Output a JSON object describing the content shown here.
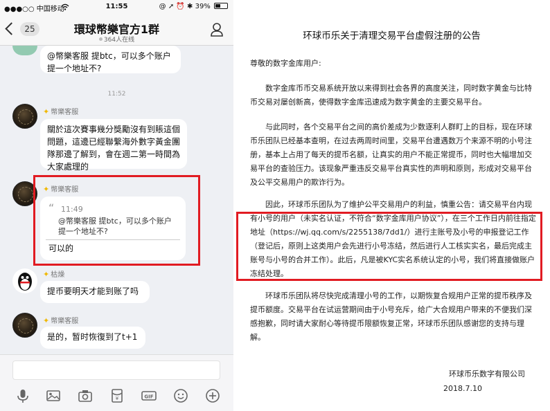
{
  "status_bar": {
    "carrier": "●●●○○ 中国移动",
    "wifi": "wifi-icon",
    "time": "11:55",
    "indicators": "@ ➚ ⏰ ✱ 39%"
  },
  "header": {
    "back_count": "25",
    "title": "環球幣樂官方1群",
    "online": "364人在线"
  },
  "chat": {
    "msg1_text": "@幣樂客服 提btc，可以多个账户提一个地址不?",
    "time_sep": "11:52",
    "msg2_sender": "幣樂客服",
    "msg2_text": "關於這次賽事幾分獎勵沒有到賬這個問題，這邊已經聯繫海外數字黃金團隊那邊了解到，會在週二第一時間為大家處理的",
    "msg3_sender": "幣樂客服",
    "msg3_quote_time": "11:49",
    "msg3_quote_text": "@幣樂客服 提btc，可以多个账户提一个地址不?",
    "msg3_text": "可以的",
    "msg4_sender": "枯燥",
    "msg4_text": "提币要明天才能到账了吗",
    "msg5_sender": "幣樂客服",
    "msg5_text": "是的，暂时恢復到了t+1"
  },
  "toolbar_icons": [
    "microphone-icon",
    "image-icon",
    "camera-icon",
    "red-packet-icon",
    "gif-icon",
    "emoji-icon",
    "plus-icon"
  ],
  "doc": {
    "title": "环球币乐关于清理交易平台虚假注册的公告",
    "salutation": "尊敬的数字金库用户:",
    "p1": "数字金库币币交易系统开放以来得到社会各界的高度关注，同时数字黄金与比特币交易对屡创新高，使得数字金库迅速成为数字黄金的主要交易平台。",
    "p2": "与此同时，各个交易平台之间的高价差成为少数逐利人群盯上的目标，现在环球币乐团队已经基本查明，在过去两周时间里，交易平台遭遇数万个来源不明的小号注册，基本上占用了每天的提币名额，让真实的用户不能正常提币，同时也大幅增加交易平台的查验压力。该现象严重违反交易平台真实性的声明和原则，形成对交易平台及公平交易用户的欺诈行为。",
    "p3": "因此，环球币乐团队为了维护公平交易用户的利益，慎重公告：请交易平台内现有小号的用户（未实名认证，不符合“数字金库用户协议”），在三个工作日内前往指定地址（https://wj.qq.com/s/2255138/7dd1/）进行主账号及小号的申报登记工作（登记后，原则上这类用户会先进行小号冻结，然后进行人工核实实名，最后完成主账号与小号的合并工作）。此后，凡是被KYC实名系统认定的小号，我们将直接做账户冻结处理。",
    "p4": "环球币乐团队将尽快完成清理小号的工作，以期恢复合规用户正常的提币秩序及提币额度。交易平台在试运营期间由于小号充斥，给广大合规用户带来的不便我们深感抱歉，同时请大家耐心等待提币限额恢复正常，环球币乐团队感谢您的支持与理解。",
    "signature_org": "环球币乐数字有限公司",
    "signature_date": "2018.7.10"
  },
  "colors": {
    "highlight_box": "#e11b22",
    "chat_bg": "#eef0f4",
    "bubble": "#ffffff"
  }
}
